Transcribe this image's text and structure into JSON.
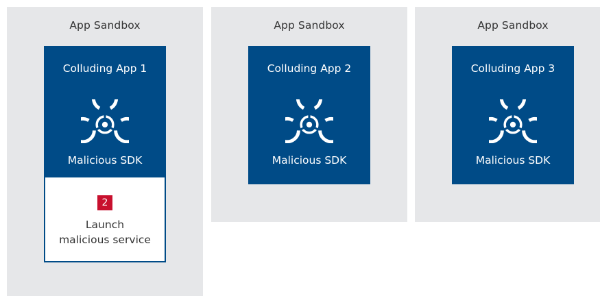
{
  "colors": {
    "sandbox_bg": "#e6e7e9",
    "app_bg": "#004b87",
    "badge_bg": "#c8102e"
  },
  "sandboxes": [
    {
      "title": "App Sandbox",
      "app": {
        "name": "Colluding App 1",
        "sdk": "Malicious SDK",
        "icon": "biohazard-icon"
      },
      "service": {
        "step": "2",
        "line1": "Launch",
        "line2": "malicious service"
      }
    },
    {
      "title": "App Sandbox",
      "app": {
        "name": "Colluding App 2",
        "sdk": "Malicious SDK",
        "icon": "biohazard-icon"
      }
    },
    {
      "title": "App Sandbox",
      "app": {
        "name": "Colluding App 3",
        "sdk": "Malicious SDK",
        "icon": "biohazard-icon"
      }
    }
  ]
}
